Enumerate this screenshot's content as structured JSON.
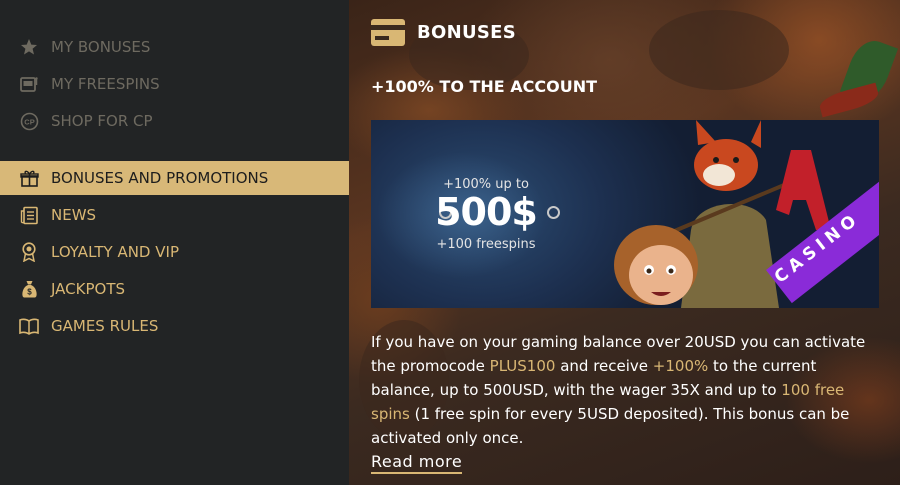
{
  "sidebar": {
    "items": [
      {
        "label": "MY BONUSES",
        "icon": "star-icon",
        "state": "dim"
      },
      {
        "label": "MY FREESPINS",
        "icon": "slot-machine-icon",
        "state": "dim"
      },
      {
        "label": "SHOP FOR CP",
        "icon": "cp-coin-icon",
        "state": "dim"
      },
      {
        "label": "BONUSES AND PROMOTIONS",
        "icon": "gift-icon",
        "state": "active"
      },
      {
        "label": "NEWS",
        "icon": "news-icon",
        "state": "normal"
      },
      {
        "label": "LOYALTY AND VIP",
        "icon": "award-ribbon-icon",
        "state": "normal"
      },
      {
        "label": "JACKPOTS",
        "icon": "money-bag-icon",
        "state": "normal"
      },
      {
        "label": "GAMES RULES",
        "icon": "open-book-icon",
        "state": "normal"
      }
    ]
  },
  "main": {
    "title": "BONUSES",
    "title_icon": "card-icon",
    "promo_title": "+100% TO THE ACCOUNT",
    "banner": {
      "line1": "+100% up to",
      "amount": "500$",
      "line3": "+100 freespins",
      "ribbon": "CASINO"
    },
    "description": {
      "p1": "If you have on your gaming balance over 20USD you can activate the promocode ",
      "code": "PLUS100",
      "p2": " and receive ",
      "percent": "+100%",
      "p3": " to the current balance, up to 500USD, with the wager 35X and up to ",
      "spins": "100 free spins",
      "p4": " (1 free spin for every 5USD deposited). This bonus can be activated only once."
    },
    "read_more": "Read more"
  },
  "colors": {
    "sidebar_bg": "#222425",
    "active_bg": "#d8b878",
    "gold_text": "#d9b774",
    "dim_text": "#6e6a60"
  }
}
